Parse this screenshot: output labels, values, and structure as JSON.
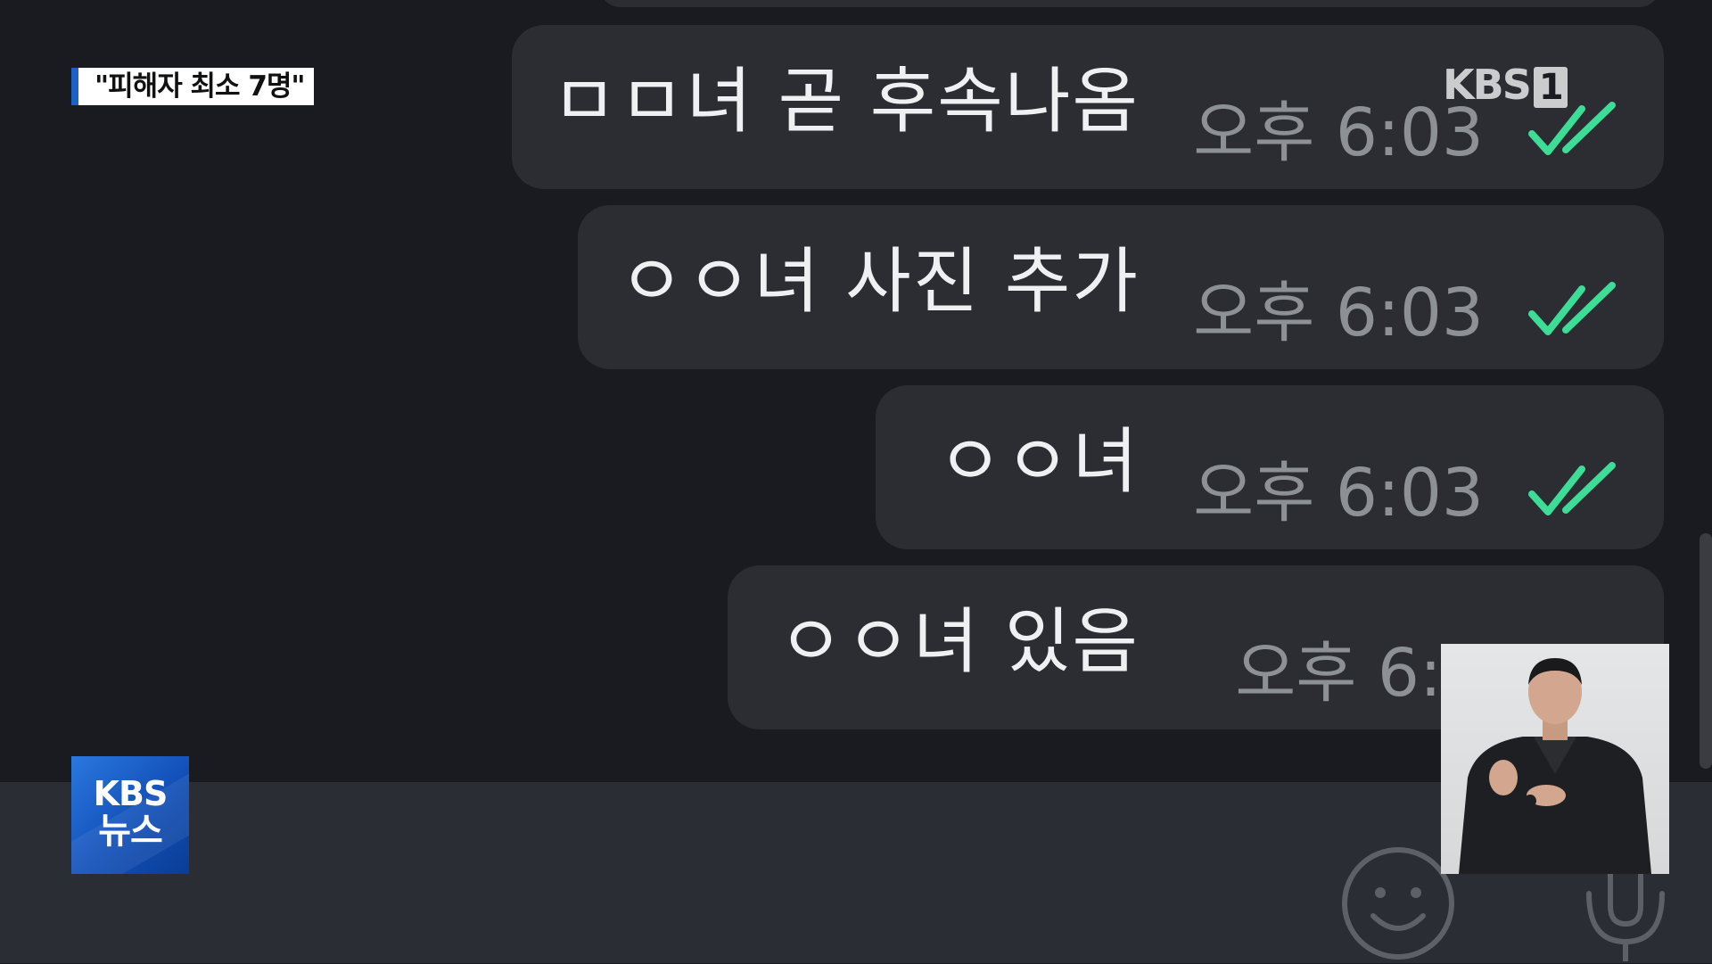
{
  "chat": {
    "messages": [
      {
        "text": "ㅁㅁ녀 곧 후속나옴",
        "time": "오후 6:03",
        "status_icon": "double-check-icon"
      },
      {
        "text": "ㅇㅇ녀 사진 추가",
        "time": "오후 6:03",
        "status_icon": "double-check-icon"
      },
      {
        "text": "ㅇㅇ녀",
        "time": "오후 6:03",
        "status_icon": "double-check-icon"
      },
      {
        "text": "ㅇㅇ녀 있음",
        "time": "오후 6:0",
        "status_icon": "double-check-icon"
      }
    ],
    "input_icons": [
      "emoji-icon",
      "microphone-icon"
    ]
  },
  "broadcast": {
    "caption": "\"피해자 최소 7명\"",
    "channel_logo": "KBS",
    "channel_logo_number": "1",
    "news_logo_line1": "KBS",
    "news_logo_line2": "뉴스"
  },
  "colors": {
    "background": "#1a1b21",
    "bubble": "#2b2d33",
    "check": "#3ddc97",
    "time_text": "#8d9196",
    "caption_accent": "#1b62c4",
    "news_logo_blue": "#1250b8"
  }
}
